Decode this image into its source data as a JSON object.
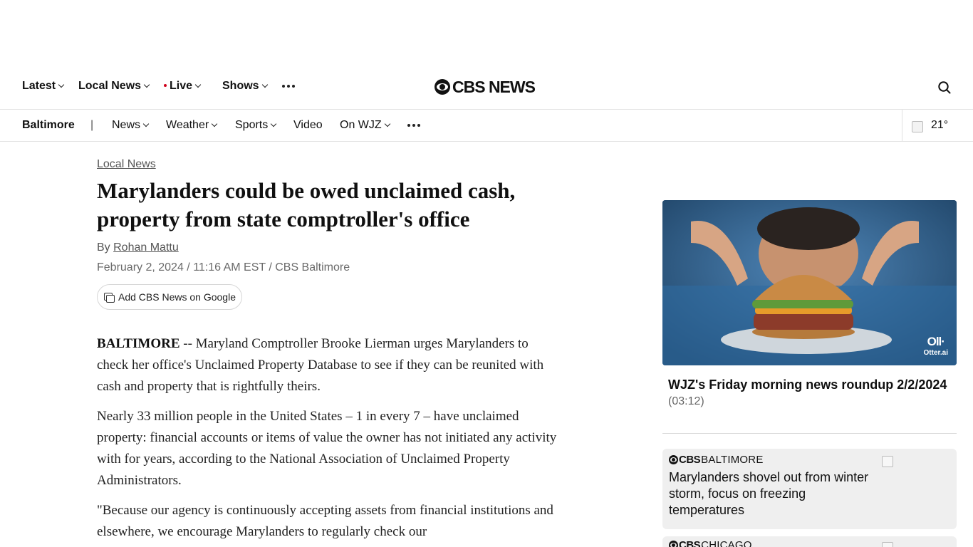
{
  "top_nav": {
    "items": [
      {
        "label": "Latest"
      },
      {
        "label": "Local News"
      },
      {
        "label": "Live"
      },
      {
        "label": "Shows"
      }
    ],
    "logo_text": "CBS NEWS",
    "icons": [
      "more-icon",
      "search-icon"
    ],
    "live_dot_color": "#d0021b"
  },
  "local_bar": {
    "city": "Baltimore",
    "separator": "|",
    "items": [
      {
        "label": "News"
      },
      {
        "label": "Weather"
      },
      {
        "label": "Sports"
      },
      {
        "label": "Video"
      },
      {
        "label": "On WJZ"
      }
    ],
    "temperature": "21°"
  },
  "article": {
    "kicker": "Local News",
    "headline": "Marylanders could be owed unclaimed cash, property from state comptroller's office",
    "byline_prefix": "By",
    "author": "Rohan Mattu",
    "dateline": "February 2, 2024 / 11:16 AM EST / CBS Baltimore",
    "google_button": "Add CBS News on Google",
    "paragraphs": [
      {
        "lead": "BALTIMORE",
        "text": " -- Maryland Comptroller Brooke Lierman urges Marylanders to check her office's Unclaimed Property Database to see if they can be reunited with cash and property that is rightfully theirs."
      },
      {
        "lead": "",
        "text": "Nearly 33 million people in the United States – 1 in every 7 – have unclaimed property: financial accounts or items of value the owner has not initiated any activity with for years, according to the National Association of Unclaimed Property Administrators."
      },
      {
        "lead": "",
        "text": "\"Because our agency is continuously accepting assets from financial institutions and elsewhere, we encourage Marylanders to regularly check our"
      }
    ]
  },
  "sidebar": {
    "video": {
      "watermark_brand": "Otter.ai",
      "title": "WJZ's Friday morning news roundup 2/2/2024",
      "duration": "(03:12)"
    },
    "cards": [
      {
        "brand": "CBS",
        "location": "BALTIMORE",
        "title": "Marylanders shovel out from winter storm, focus on freezing temperatures"
      },
      {
        "brand": "CBS",
        "location": "CHICAGO",
        "title": ""
      }
    ]
  }
}
